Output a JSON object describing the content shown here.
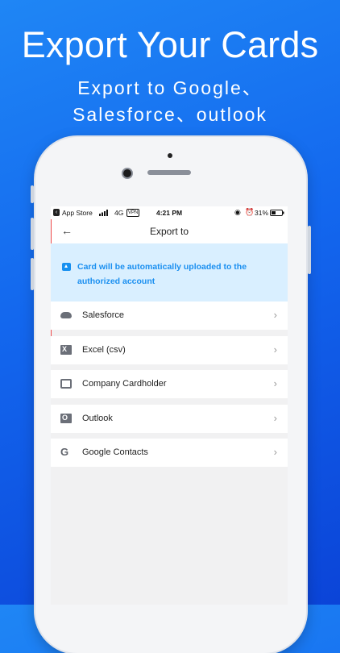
{
  "promo": {
    "headline": "Export Your Cards",
    "subline1": "Export to Google、",
    "subline2": "Salesforce、outlook"
  },
  "status_bar": {
    "carrier": "App Store",
    "network": "4G",
    "vpn": "VPN",
    "time": "4:21 PM",
    "battery": "31%"
  },
  "navbar": {
    "back": "←",
    "title": "Export to"
  },
  "banner": {
    "icon": "upload-icon",
    "text": "Card will be automatically uploaded to the authorized account"
  },
  "export_options": [
    {
      "label": "Salesforce",
      "icon": "salesforce-cloud-icon",
      "chevron": "›"
    },
    {
      "label": "Excel (csv)",
      "icon": "excel-icon",
      "chevron": "›"
    },
    {
      "label": "Company Cardholder",
      "icon": "cardholder-icon",
      "chevron": "›"
    },
    {
      "label": "Outlook",
      "icon": "outlook-icon",
      "chevron": "›"
    },
    {
      "label": "Google Contacts",
      "icon": "google-icon",
      "google_letter": "G",
      "chevron": "›"
    }
  ],
  "colors": {
    "background_top": "#1f86f5",
    "background_bottom": "#0b44d8",
    "banner_bg": "#d9efff",
    "banner_text": "#1a8ff0",
    "accent_red": "#f04c4c"
  }
}
